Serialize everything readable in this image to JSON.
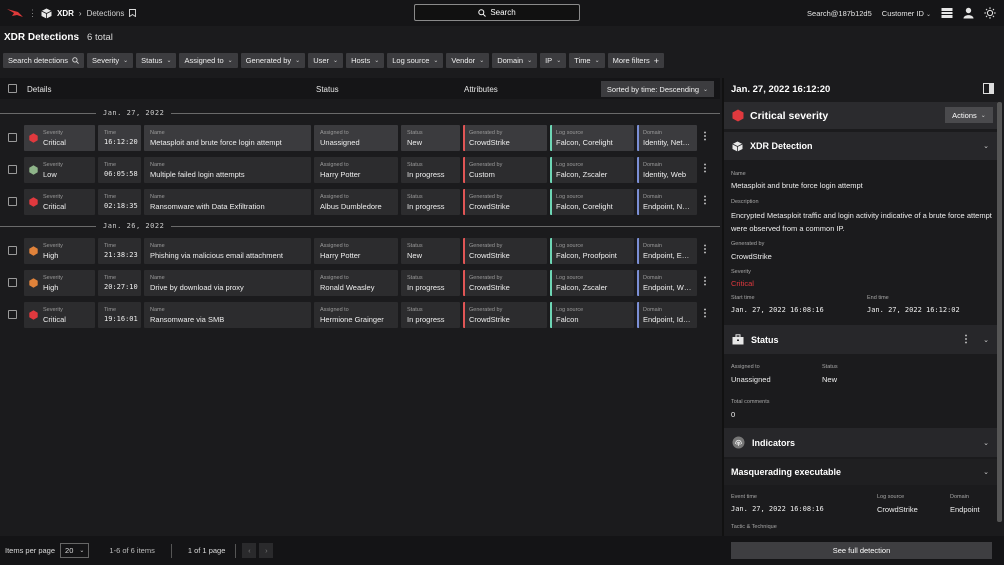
{
  "header": {
    "app_name": "XDR",
    "breadcrumb": "Detections",
    "search_label": "Search",
    "user": "Search@187b12d5",
    "customer_id": "Customer ID"
  },
  "page": {
    "title": "XDR Detections",
    "count": "6 total"
  },
  "filters": [
    "Search detections",
    "Severity",
    "Status",
    "Assigned to",
    "Generated by",
    "User",
    "Hosts",
    "Log source",
    "Vendor",
    "Domain",
    "IP",
    "Time",
    "More filters"
  ],
  "list_header": {
    "details": "Details",
    "status": "Status",
    "attributes": "Attributes",
    "sort": "Sorted by time: Descending"
  },
  "date_groups": [
    "Jan. 27, 2022",
    "Jan. 26, 2022"
  ],
  "labels": {
    "severity": "Severity",
    "time": "Time",
    "name": "Name",
    "assigned": "Assigned to",
    "status": "Status",
    "generated": "Generated by",
    "log_source": "Log source",
    "domain": "Domain"
  },
  "rows": [
    {
      "severity": "Critical",
      "time": "16:12:20",
      "name": "Metasploit and brute force login attempt",
      "assigned": "Unassigned",
      "status": "New",
      "generated": "CrowdStrike",
      "log_source": "Falcon, Corelight",
      "domain": "Identity, Net…"
    },
    {
      "severity": "Low",
      "time": "06:05:58",
      "name": "Multiple failed login attempts",
      "assigned": "Harry Potter",
      "status": "In progress",
      "generated": "Custom",
      "log_source": "Falcon, Zscaler",
      "domain": "Identity, Web"
    },
    {
      "severity": "Critical",
      "time": "02:18:35",
      "name": "Ransomware with Data Exfiltration",
      "assigned": "Albus Dumbledore",
      "status": "In progress",
      "generated": "CrowdStrike",
      "log_source": "Falcon, Corelight",
      "domain": "Endpoint, N…"
    },
    {
      "severity": "High",
      "time": "21:38:23",
      "name": "Phishing via malicious email attachment",
      "assigned": "Harry Potter",
      "status": "New",
      "generated": "CrowdStrike",
      "log_source": "Falcon, Proofpoint",
      "domain": "Endpoint, E…"
    },
    {
      "severity": "High",
      "time": "20:27:10",
      "name": "Drive by download via proxy",
      "assigned": "Ronald Weasley",
      "status": "In progress",
      "generated": "CrowdStrike",
      "log_source": "Falcon, Zscaler",
      "domain": "Endpoint, W…"
    },
    {
      "severity": "Critical",
      "time": "19:16:01",
      "name": "Ransomware via SMB",
      "assigned": "Hermione Grainger",
      "status": "In progress",
      "generated": "CrowdStrike",
      "log_source": "Falcon",
      "domain": "Endpoint, Id…"
    }
  ],
  "footer": {
    "items_per_page_label": "Items per page",
    "per_page": "20",
    "range": "1-6 of 6 items",
    "pages": "1 of 1 page"
  },
  "panel": {
    "timestamp": "Jan. 27, 2022 16:12:20",
    "severity_title": "Critical severity",
    "actions": "Actions",
    "xdr_section": "XDR Detection",
    "name_label": "Name",
    "name_value": "Metasploit and brute force login attempt",
    "desc_label": "Description",
    "desc_value": "Encrypted Metasploit traffic and login activity indicative of a brute force attempt were observed from a common IP.",
    "gen_label": "Generated by",
    "gen_value": "CrowdStrike",
    "sev_label": "Severity",
    "sev_value": "Critical",
    "start_label": "Start time",
    "start_value": "Jan. 27, 2022 16:08:16",
    "end_label": "End time",
    "end_value": "Jan. 27, 2022 16:12:02",
    "status_section": "Status",
    "assigned_label": "Assigned to",
    "assigned_value": "Unassigned",
    "status_label": "Status",
    "status_value": "New",
    "comments_label": "Total comments",
    "comments_value": "0",
    "indicators_section": "Indicators",
    "masq_section": "Masquerading executable",
    "event_label": "Event time",
    "event_value": "Jan. 27, 2022 16:08:16",
    "logsrc_label": "Log source",
    "logsrc_value": "CrowdStrike",
    "domain_label": "Domain",
    "domain_value": "Endpoint",
    "tactic_label": "Tactic & Technique",
    "see_full": "See full detection"
  },
  "colors": {
    "critical": "#e0393e",
    "high": "#e0823a",
    "low": "#8fb58a",
    "crowdstrike": "#e05555",
    "custom": "#e05555",
    "falcon": "#6ed6b5",
    "domain": "#7b8fd6"
  }
}
